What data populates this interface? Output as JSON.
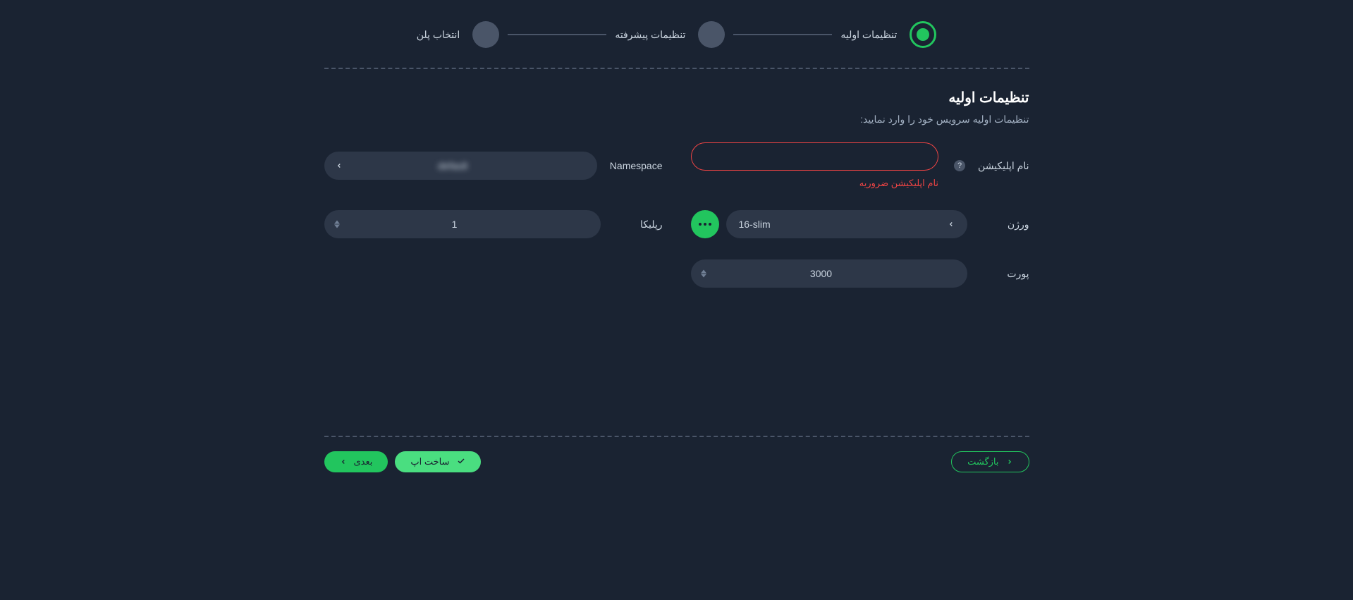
{
  "stepper": {
    "step1": "تنظیمات اولیه",
    "step2": "تنظیمات پیشرفته",
    "step3": "انتخاب پلن"
  },
  "section": {
    "title": "تنظیمات اولیه",
    "subtitle": "تنظیمات اولیه سرویس خود را وارد نمایید:"
  },
  "form": {
    "appNameLabel": "نام اپلیکیشن",
    "appNameError": "نام اپلیکیشن ضروریه",
    "namespaceLabel": "Namespace",
    "namespaceValue": "default",
    "versionLabel": "ورژن",
    "versionValue": "16-slim",
    "replicaLabel": "رپلیکا",
    "replicaValue": "1",
    "portLabel": "پورت",
    "portValue": "3000"
  },
  "footer": {
    "back": "بازگشت",
    "create": "ساخت اپ",
    "next": "بعدی"
  }
}
